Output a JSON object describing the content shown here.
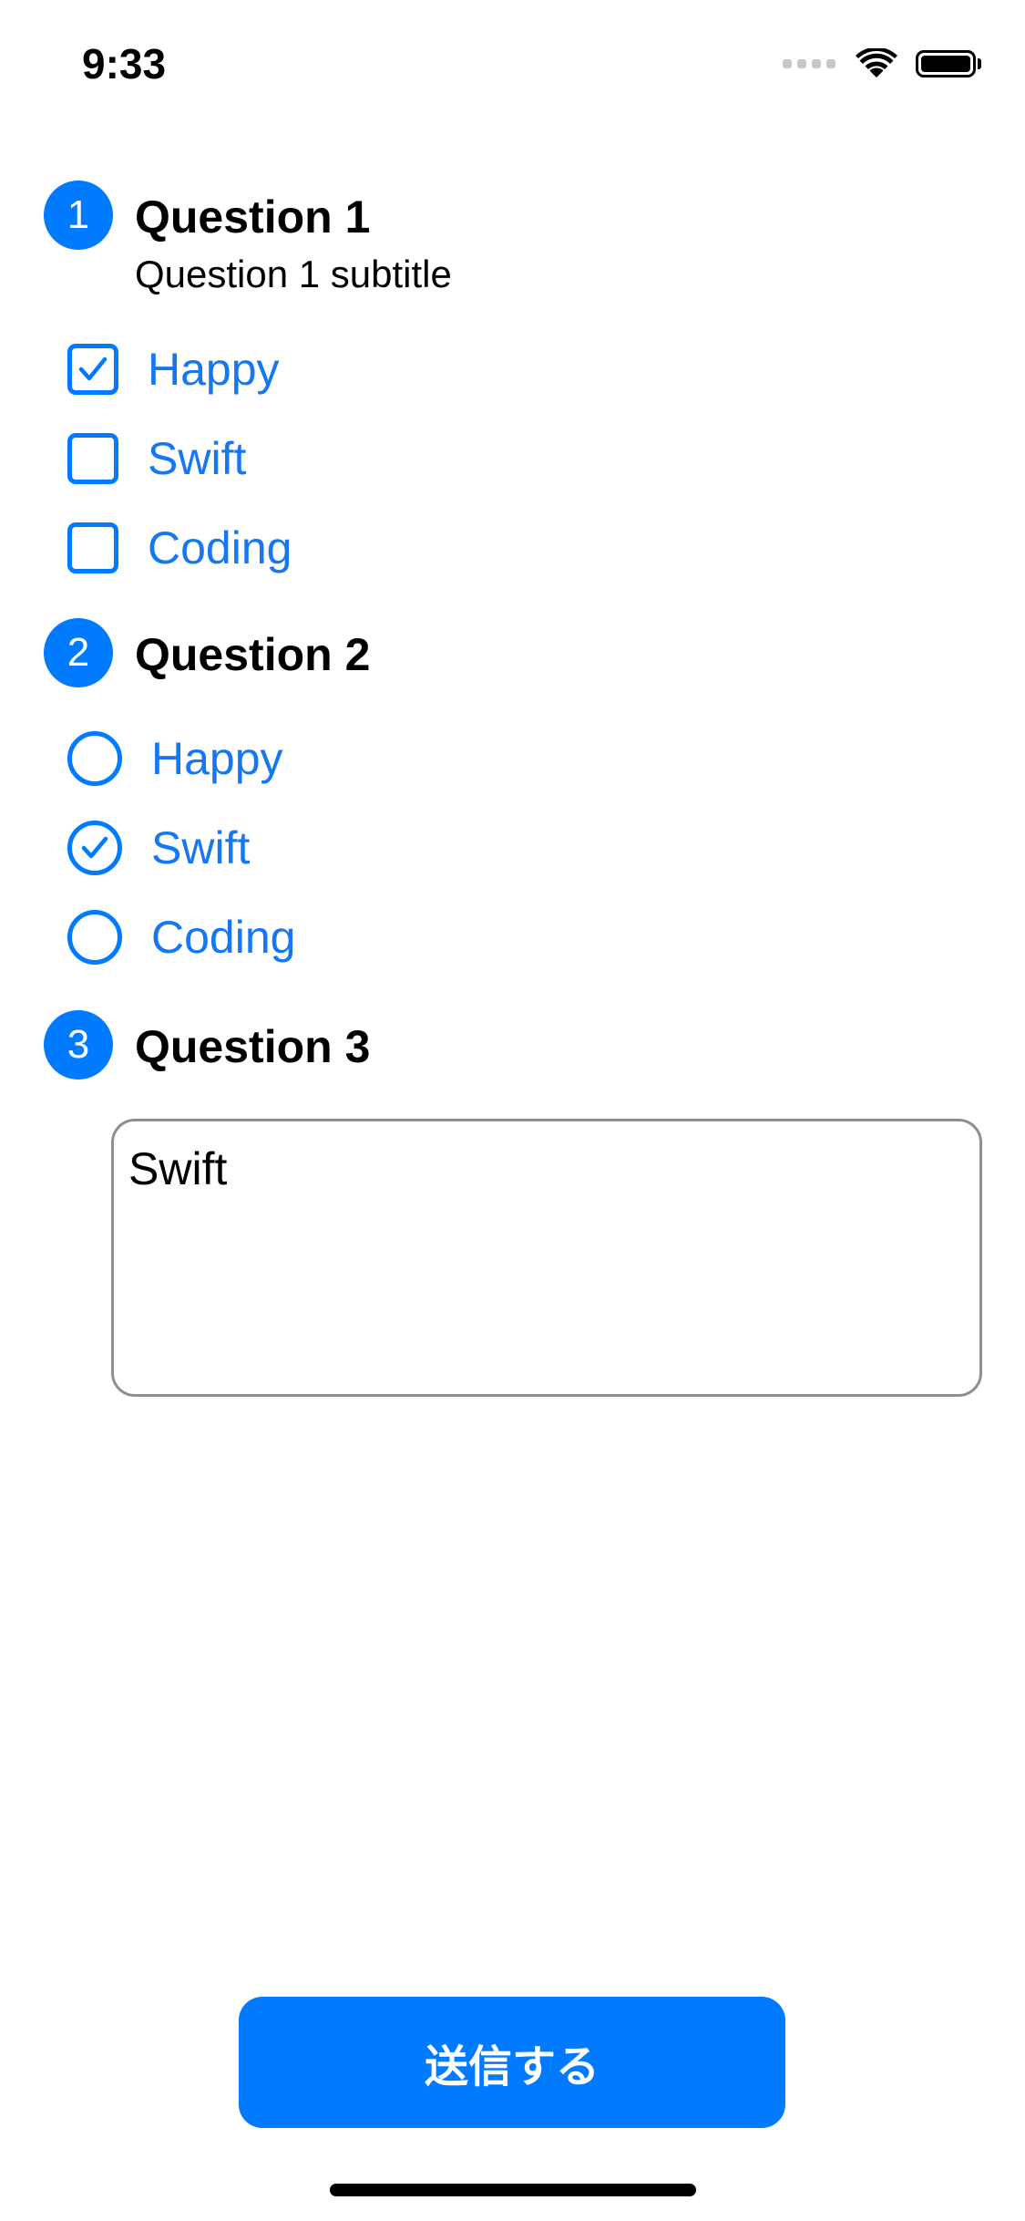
{
  "status_bar": {
    "time": "9:33",
    "signal_icon": "signal-dots-icon",
    "wifi_icon": "wifi-icon",
    "battery_icon": "battery-full-icon",
    "battery_level": 1.0
  },
  "accent_color": "#007aff",
  "questions": [
    {
      "number": "1",
      "title": "Question 1",
      "subtitle": "Question 1 subtitle",
      "type": "checkbox",
      "options": [
        {
          "label": "Happy",
          "selected": true
        },
        {
          "label": "Swift",
          "selected": false
        },
        {
          "label": "Coding",
          "selected": false
        }
      ]
    },
    {
      "number": "2",
      "title": "Question 2",
      "type": "radio",
      "options": [
        {
          "label": "Happy",
          "selected": false
        },
        {
          "label": "Swift",
          "selected": true
        },
        {
          "label": "Coding",
          "selected": false
        }
      ]
    },
    {
      "number": "3",
      "title": "Question 3",
      "type": "text",
      "value": "Swift"
    }
  ],
  "submit_label": "送信する"
}
